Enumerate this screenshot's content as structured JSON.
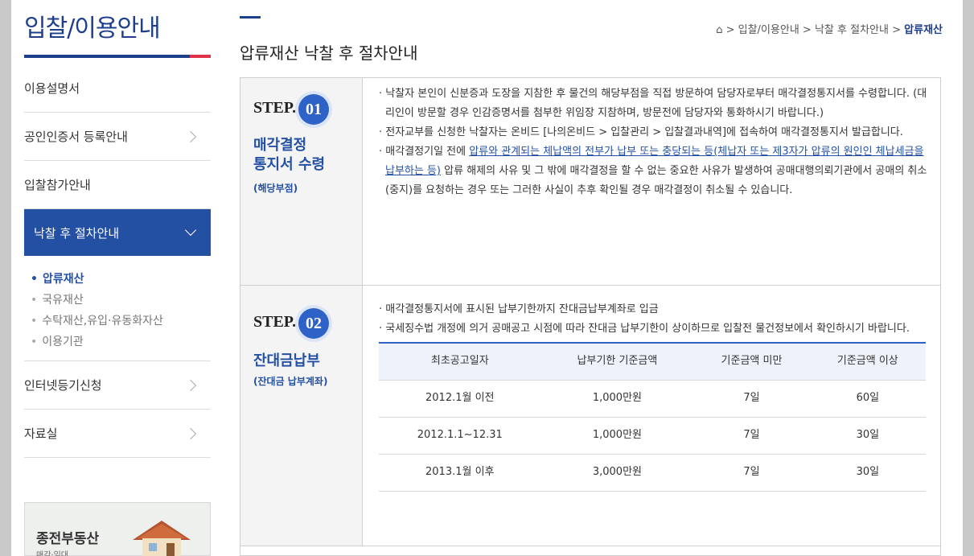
{
  "sidebar": {
    "title": "입찰/이용안내",
    "menu": [
      {
        "label": "이용설명서"
      },
      {
        "label": "공인인증서 등록안내"
      },
      {
        "label": "입찰참가안내"
      },
      {
        "label": "낙찰 후 절차안내"
      },
      {
        "label": "인터넷등기신청"
      },
      {
        "label": "자료실"
      }
    ],
    "submenu": [
      {
        "label": "압류재산"
      },
      {
        "label": "국유재산"
      },
      {
        "label": "수탁재산,유입·유동화자산"
      },
      {
        "label": "이용기관"
      }
    ],
    "banner": {
      "title": "종전부동산",
      "subtitle": "매각·임대"
    }
  },
  "header": {
    "page_title": "압류재산 낙찰 후 절차안내",
    "breadcrumb": {
      "home_icon": "home-icon",
      "sep": ">",
      "items": [
        "입찰/이용안내",
        "낙찰 후 절차안내"
      ],
      "current": "압류재산"
    }
  },
  "steps": [
    {
      "label": "STEP.",
      "num": "01",
      "title_line1": "매각결정",
      "title_line2": "통지서 수령",
      "sub": "(해당부점)",
      "bullets": [
        {
          "text": "낙찰자 본인이 신분증과 도장을 지참한 후 물건의 해당부점을 직접 방문하여 담당자로부터 매각결정통지서를 수령합니다. (대리인이 방문할 경우 인감증명서를 첨부한 위임장 지참하며, 방문전에 담당자와 통화하시기 바랍니다.)"
        },
        {
          "text": "전자교부를 신청한 낙찰자는 온비드 [나의온비드 > 입찰관리 > 입찰결과내역]에 접속하여 매각결정통지서 발급합니다."
        },
        {
          "pre": "매각결정기일 전에 ",
          "link": "압류와 관계되는 체납액의 전부가 납부 또는 충당되는 등(체납자 또는 제3자가 압류의 원인인 체납세금을 납부하는 등)",
          "post": " 압류 해제의 사유 및 그 밖에 매각결정을 할 수 없는 중요한 사유가 발생하여 공매대행의뢰기관에서 공매의 취소(중지)를 요청하는 경우 또는 그러한 사실이 추후 확인될 경우 매각결정이 취소될 수 있습니다."
        }
      ]
    },
    {
      "label": "STEP.",
      "num": "02",
      "title_line1": "잔대금납부",
      "sub": "(잔대금 납부계좌)",
      "bullets": [
        {
          "text": "매각결정통지서에 표시된 납부기한까지 잔대금납부계좌로 입금"
        },
        {
          "text": "국세징수법 개정에 의거 공매공고 시점에 따라 잔대금 납부기한이 상이하므로 입찰전 물건정보에서 확인하시기 바랍니다."
        }
      ],
      "table": {
        "headers": [
          "최초공고일자",
          "납부기한 기준금액",
          "기준금액 미만",
          "기준금액 이상"
        ],
        "rows": [
          [
            "2012.1월 이전",
            "1,000만원",
            "7일",
            "60일"
          ],
          [
            "2012.1.1~12.31",
            "1,000만원",
            "7일",
            "30일"
          ],
          [
            "2013.1월 이후",
            "3,000만원",
            "7일",
            "30일"
          ]
        ]
      }
    }
  ],
  "colors": {
    "brand": "#1e3f8b",
    "accent": "#e0324b",
    "active_menu": "#2450a3",
    "step_badge": "#2e62c6"
  }
}
